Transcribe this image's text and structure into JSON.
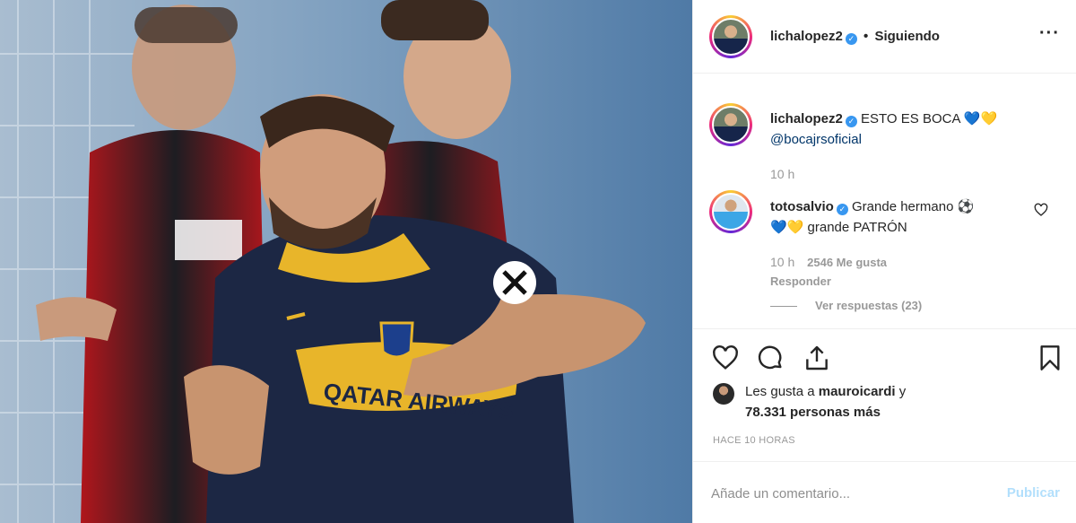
{
  "post": {
    "image_alt": "Jugador de Boca Juniors celebrando un gol",
    "jersey_text": "QATAR AIRWAYS"
  },
  "header": {
    "username": "lichalopez2",
    "separator": "•",
    "follow_status": "Siguiendo",
    "more_icon": "ellipsis-icon"
  },
  "caption": {
    "username": "lichalopez2",
    "text": "ESTO ES BOCA 💙💛",
    "mention": "@bocajrsoficial",
    "time": "10 h"
  },
  "comment": {
    "username": "totosalvio",
    "text_line1": "Grande hermano ⚽",
    "text_line2": "💙💛 grande PATRÓN",
    "time": "10 h",
    "likes": "2546 Me gusta",
    "reply": "Responder",
    "view_replies": "Ver respuestas (23)"
  },
  "actions": {
    "like_icon": "heart-icon",
    "comment_icon": "comment-icon",
    "share_icon": "share-icon",
    "save_icon": "bookmark-icon"
  },
  "likes": {
    "prefix": "Les gusta a",
    "user": "mauroicardi",
    "connector": "y",
    "others": "78.331 personas más"
  },
  "timestamp": "HACE 10 HORAS",
  "comment_input": {
    "placeholder": "Añade un comentario...",
    "publish_label": "Publicar"
  },
  "colors": {
    "link": "#003569",
    "verified": "#3897f0",
    "publish_disabled": "#b2dffc"
  }
}
